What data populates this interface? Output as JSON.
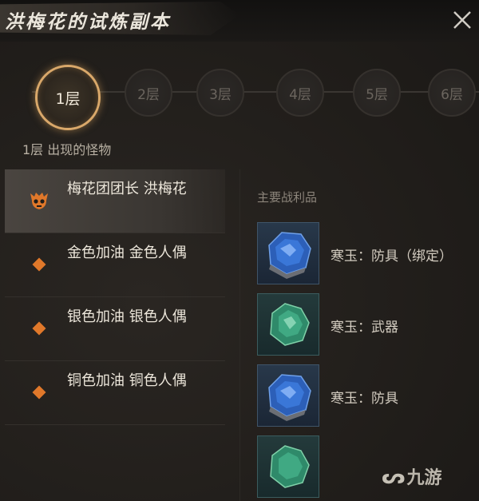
{
  "header": {
    "title": "洪梅花的试炼副本",
    "close_icon": "close-icon"
  },
  "floors": [
    {
      "label": "1层",
      "active": true
    },
    {
      "label": "2层",
      "active": false
    },
    {
      "label": "3层",
      "active": false
    },
    {
      "label": "4层",
      "active": false
    },
    {
      "label": "5层",
      "active": false
    },
    {
      "label": "6层",
      "active": false
    }
  ],
  "floor_caption": "1层 出现的怪物",
  "monsters": [
    {
      "name": "梅花团团长 洪梅花",
      "icon": "boss-skull-icon",
      "active": true
    },
    {
      "name": "金色加油 金色人偶",
      "icon": "diamond-icon",
      "active": false
    },
    {
      "name": "银色加油 银色人偶",
      "icon": "diamond-icon",
      "active": false
    },
    {
      "name": "铜色加油 铜色人偶",
      "icon": "diamond-icon",
      "active": false
    }
  ],
  "loot": {
    "header": "主要战利品",
    "items": [
      {
        "name": "寒玉：防具（绑定）",
        "icon": "blue-jade-icon"
      },
      {
        "name": "寒玉：武器",
        "icon": "green-jade-icon"
      },
      {
        "name": "寒玉：防具",
        "icon": "blue-jade-icon"
      },
      {
        "name": "",
        "icon": "green-jade-icon"
      }
    ]
  },
  "watermark": "九游",
  "colors": {
    "accent_gold": "#d9a86a",
    "monster_orange": "#e0782a",
    "background": "#23201d"
  }
}
